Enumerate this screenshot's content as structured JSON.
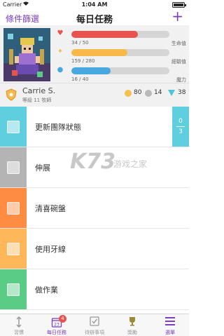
{
  "status_bar": {
    "carrier": "Carrier",
    "time": "1:04 AM"
  },
  "nav": {
    "left_label": "條件篩選",
    "title": "每日任務",
    "add_label": "+"
  },
  "stats": [
    {
      "name": "health",
      "icon": "heart-icon",
      "glyph": "♥",
      "color": "#e9534f",
      "value_text": "34 / 50",
      "label": "生命值",
      "fraction": 0.68
    },
    {
      "name": "experience",
      "icon": "star-icon",
      "glyph": "✦",
      "color": "#f6b94a",
      "value_text": "159 / 280",
      "label": "經驗值",
      "fraction": 0.568
    },
    {
      "name": "mana",
      "icon": "droplet-icon",
      "glyph": "●",
      "color": "#4aa8e0",
      "value_text": "16 / 40",
      "label": "魔力",
      "fraction": 0.4
    }
  ],
  "user": {
    "name": "Carrie S.",
    "level": "等級 11 牧師",
    "gold": "80",
    "silver": "14",
    "gems": "38"
  },
  "tasks": [
    {
      "text": "更新團隊狀態",
      "color": "#5fcfe0"
    },
    {
      "text": "伸展",
      "color": "#b4b4b4"
    },
    {
      "text": "清喜碗盤",
      "color": "#ff8c42"
    },
    {
      "text": "使用牙線",
      "color": "#ffb75a"
    },
    {
      "text": "做作業",
      "color": "#5bcc86"
    }
  ],
  "task_counter": {
    "top": "0",
    "bottom": "3"
  },
  "watermark": {
    "big": "K73",
    "small": "游戏之家"
  },
  "tabs": [
    {
      "label": "習慣",
      "icon": "habits-icon"
    },
    {
      "label": "每日任務",
      "icon": "calendar-icon",
      "badge": "4",
      "day": "23"
    },
    {
      "label": "待辦事項",
      "icon": "checklist-icon"
    },
    {
      "label": "獎勵",
      "icon": "trophy-icon"
    },
    {
      "label": "選單",
      "icon": "menu-icon"
    }
  ],
  "colors": {
    "accent": "#7b3fbf",
    "health": "#e9534f",
    "experience": "#f6b94a",
    "mana": "#4aa8e0"
  }
}
